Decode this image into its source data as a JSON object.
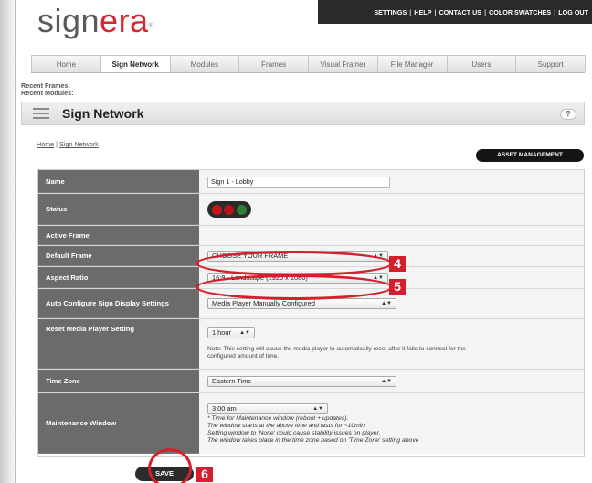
{
  "brand": {
    "logo_main": "sign",
    "logo_accent": "era",
    "logo_mark": "®"
  },
  "topnav": {
    "items": [
      "SETTINGS",
      "HELP",
      "CONTACT US",
      "COLOR SWATCHES",
      "LOG OUT"
    ],
    "separator": "|"
  },
  "tabs": [
    "Home",
    "Sign Network",
    "Modules",
    "Frames",
    "Visual Framer",
    "File Manager",
    "Users",
    "Support"
  ],
  "active_tab": "Sign Network",
  "recent": {
    "frames": "Recent Frames:",
    "modules": "Recent Modules:"
  },
  "page": {
    "title": "Sign Network",
    "help": "?"
  },
  "breadcrumb": {
    "home": "Home",
    "sep": " | ",
    "current": "Sign Network"
  },
  "asset_button": "ASSET MANAGEMENT",
  "form": {
    "name_label": "Name",
    "name_value": "Sign 1 - Lobby",
    "status_label": "Status",
    "active_frame_label": "Active Frame",
    "default_frame_label": "Default Frame",
    "default_frame_value": "CHOOSE YOUR FRAME",
    "aspect_label": "Aspect Ratio",
    "aspect_value": "16:9 - Landscape (1920 x 1080)",
    "autoconfig_label": "Auto Configure Sign Display Settings",
    "autoconfig_value": "Media Player Manually Configured",
    "reset_label": "Reset Media Player Setting",
    "reset_value": "1 hour",
    "reset_note": "Note: This setting will cause the media player to automatically reset after it fails to connect for the configured amount of time.",
    "timezone_label": "Time Zone",
    "timezone_value": "Eastern Time",
    "maint_label": "Maintenance Window",
    "maint_value": "3:00 am",
    "maint_note_1": "* Time for Maintenance window (reboot + updates).",
    "maint_note_2": "The window starts at the above time and lasts for ~10min",
    "maint_note_3": "Setting window to 'None' could cause stability issues on player.",
    "maint_note_4": "The window takes place in the time zone based on 'Time Zone' setting above"
  },
  "save_button": "SAVE",
  "callouts": {
    "c4": "4",
    "c5": "5",
    "c6": "6"
  },
  "icons": {
    "menu": "hamburger-icon",
    "select_arrows": "updown-arrows-icon"
  },
  "colors": {
    "accent": "#d4202c",
    "label_bg": "#6b6b6b",
    "topnav_bg": "#2a2a2a",
    "status_red": "#c8151b",
    "status_green": "#2e7d32"
  }
}
